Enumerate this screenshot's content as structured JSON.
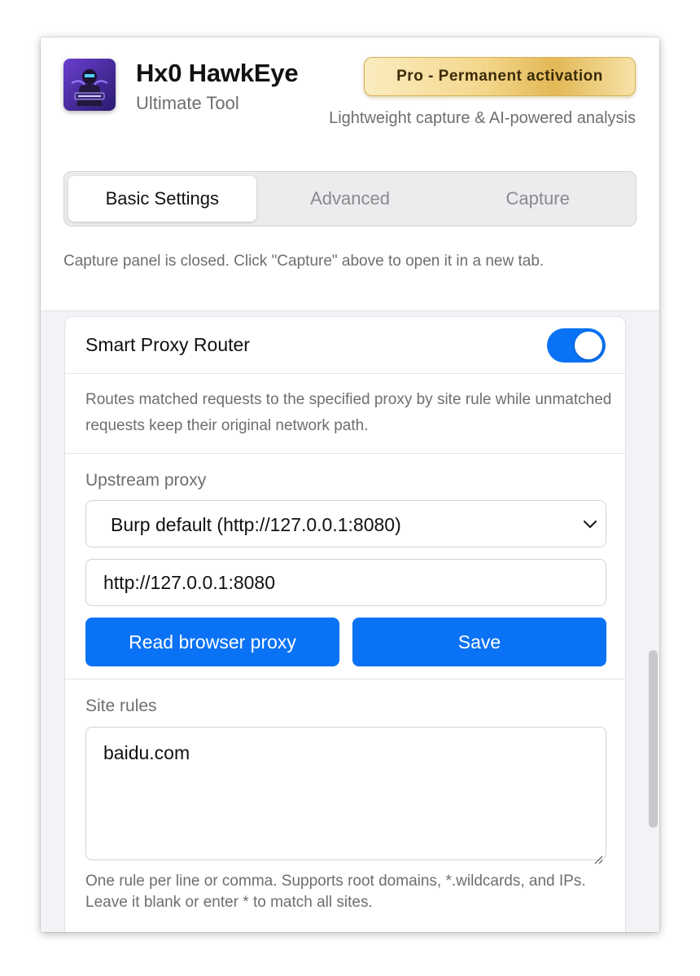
{
  "app": {
    "name": "Hx0 HawkEye",
    "subtitle": "Ultimate Tool",
    "badge": "Pro - Permanent activation",
    "tagline": "Lightweight capture & AI-powered analysis"
  },
  "tabs": [
    {
      "label": "Basic Settings",
      "active": true
    },
    {
      "label": "Advanced",
      "active": false
    },
    {
      "label": "Capture",
      "active": false
    }
  ],
  "notice": "Capture panel is closed. Click \"Capture\" above to open it in a new tab.",
  "proxy_router": {
    "title": "Smart Proxy Router",
    "enabled": true,
    "description": "Routes matched requests to the specified proxy by site rule while unmatched requests keep their original network path.",
    "upstream_label": "Upstream proxy",
    "upstream_selected": "Burp default (http://127.0.0.1:8080)",
    "proxy_url": "http://127.0.0.1:8080",
    "read_button": "Read browser proxy",
    "save_button": "Save",
    "site_rules_label": "Site rules",
    "site_rules_value": "baidu.com",
    "site_rules_help": "One rule per line or comma. Supports root domains, *.wildcards, and IPs. Leave it blank or enter * to match all sites."
  },
  "colors": {
    "accent": "#0a72f5",
    "badge_gold": "#e3b856",
    "muted_text": "#6e6e73",
    "background": "#f2f2f7"
  },
  "icons": {
    "logo": "hawkeye-logo",
    "select_arrow": "chevron-down-icon",
    "resize": "resize-grip-icon"
  }
}
